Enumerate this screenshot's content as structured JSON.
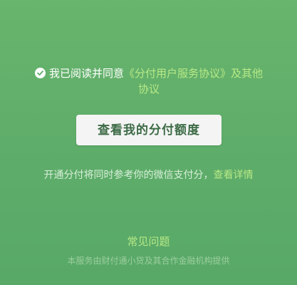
{
  "agreement": {
    "prefix": "我已阅读并同意",
    "link_text": "《分付用户服务协议》及其他协议",
    "checked": true
  },
  "cta": {
    "label": "查看我的分付额度"
  },
  "info": {
    "text": "开通分付将同时参考你的微信支付分，",
    "link_text": "查看详情"
  },
  "faq": {
    "label": "常见问题"
  },
  "footer": {
    "text": "本服务由财付通小贷及其合作金融机构提供"
  },
  "colors": {
    "background": "#5fad6a",
    "link": "#b8e986",
    "button_bg": "#f4f4f4",
    "button_text": "#3d6b46"
  }
}
